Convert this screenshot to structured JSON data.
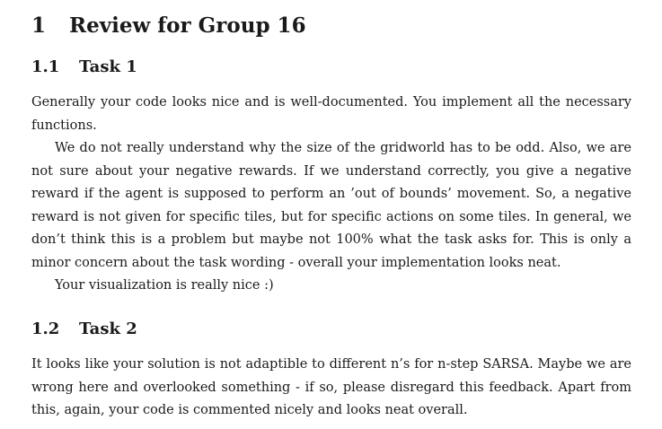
{
  "section": {
    "number": "1",
    "title": "Review for Group 16"
  },
  "subsections": [
    {
      "number": "1.1",
      "title": "Task 1",
      "paragraphs": [
        "Generally your code looks nice and is well-documented. You implement all the necessary functions.",
        "We do not really understand why the size of the gridworld has to be odd. Also, we are not sure about your negative rewards. If we understand correctly, you give a negative reward if the agent is supposed to perform an ’out of bounds’ movement. So, a negative reward is not given for specific tiles, but for specific actions on some tiles. In general, we don’t think this is a problem but maybe not 100% what the task asks for. This is only a minor concern about the task wording - overall your implementation looks neat.",
        "Your visualization is really nice :)"
      ]
    },
    {
      "number": "1.2",
      "title": "Task 2",
      "paragraphs": [
        "It looks like your solution is not adaptible to different n’s for n-step SARSA. Maybe we are wrong here and overlooked something - if so, please disregard this feedback. Apart from this, again, your code is commented nicely and looks neat overall."
      ]
    }
  ]
}
